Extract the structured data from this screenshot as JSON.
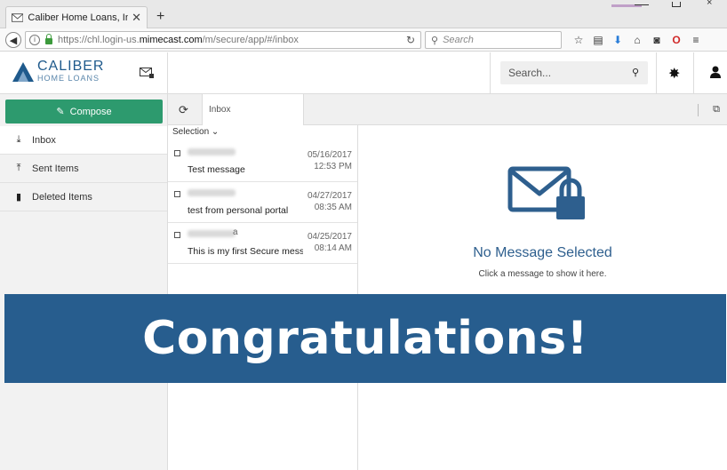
{
  "browser": {
    "tab_title": "Caliber Home Loans, Inc Sec",
    "tab_close": "✕",
    "new_tab": "+",
    "url_prefix": "https://chl.login-us.",
    "url_domain": "mimecast.com",
    "url_suffix": "/m/secure/app/#/inbox",
    "search_placeholder": "Search"
  },
  "app": {
    "logo_line1": "CALIBER",
    "logo_line2": "HOME LOANS",
    "search_placeholder": "Search...",
    "accent_color": "#2d9a6e",
    "brand_color": "#275d8e"
  },
  "sidebar": {
    "compose_label": "Compose",
    "items": [
      {
        "label": "Inbox",
        "icon": "inbox-icon"
      },
      {
        "label": "Sent Items",
        "icon": "sent-icon"
      },
      {
        "label": "Deleted Items",
        "icon": "trash-icon"
      }
    ]
  },
  "list": {
    "tab_label": "Inbox",
    "selection_label": "Selection ⌄",
    "messages": [
      {
        "sender_tail": "",
        "subject": "Test message",
        "date": "05/16/2017",
        "time": "12:53 PM"
      },
      {
        "sender_tail": "",
        "subject": "test from personal portal",
        "date": "04/27/2017",
        "time": "08:35 AM"
      },
      {
        "sender_tail": "a",
        "subject": "This is my first Secure messa",
        "date": "04/25/2017",
        "time": "08:14 AM"
      }
    ]
  },
  "reading": {
    "title": "No Message Selected",
    "subtitle": "Click a message to show it here."
  },
  "banner": {
    "text": "Congratulations!"
  }
}
